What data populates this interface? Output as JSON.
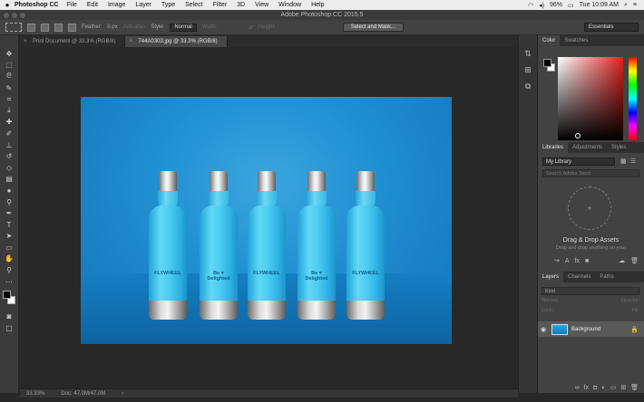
{
  "menubar": {
    "apple": "",
    "app": "Photoshop CC",
    "items": [
      "File",
      "Edit",
      "Image",
      "Layer",
      "Type",
      "Select",
      "Filter",
      "3D",
      "View",
      "Window",
      "Help"
    ],
    "battery": "96%",
    "time": "Tue 10:09 AM"
  },
  "window": {
    "title": "Adobe Photoshop CC 2015.5"
  },
  "options": {
    "feather_label": "Feather:",
    "feather_value": "0 px",
    "antialias": "Anti-alias",
    "style_label": "Style:",
    "style_value": "Normal",
    "width_label": "Width:",
    "height_label": "Height:",
    "select_mask": "Select and Mask...",
    "workspace": "Essentials"
  },
  "tabs": [
    {
      "label": "Print Document @ 33.3% (RGB/8)"
    },
    {
      "label": "744A0303.jpg @ 33.3% (RGB/8)"
    }
  ],
  "bottles": [
    {
      "logo": "FLYWHEEL"
    },
    {
      "logo": "Be ♥ Delighted"
    },
    {
      "logo": "FLYWHEEL"
    },
    {
      "logo": "Be ♥ Delighted"
    },
    {
      "logo": "FLYWHEEL"
    }
  ],
  "panels": {
    "color_tabs": [
      "Color",
      "Swatches"
    ],
    "library_tabs": [
      "Libraries",
      "Adjustments",
      "Styles"
    ],
    "library_select": "My Library",
    "library_search": "Search Adobe Stock",
    "drop_title": "Drag & Drop Assets",
    "drop_sub": "Drag and drop anything on your",
    "layers_tabs": [
      "Layers",
      "Channels",
      "Paths"
    ],
    "kind": "Kind",
    "blend_mode": "Normal",
    "opacity": "Opacity:",
    "lock": "Lock:",
    "fill": "Fill:",
    "layer_name": "Background"
  },
  "status": {
    "zoom": "33.33%",
    "doc": "Doc: 47.0M/47.0M"
  }
}
